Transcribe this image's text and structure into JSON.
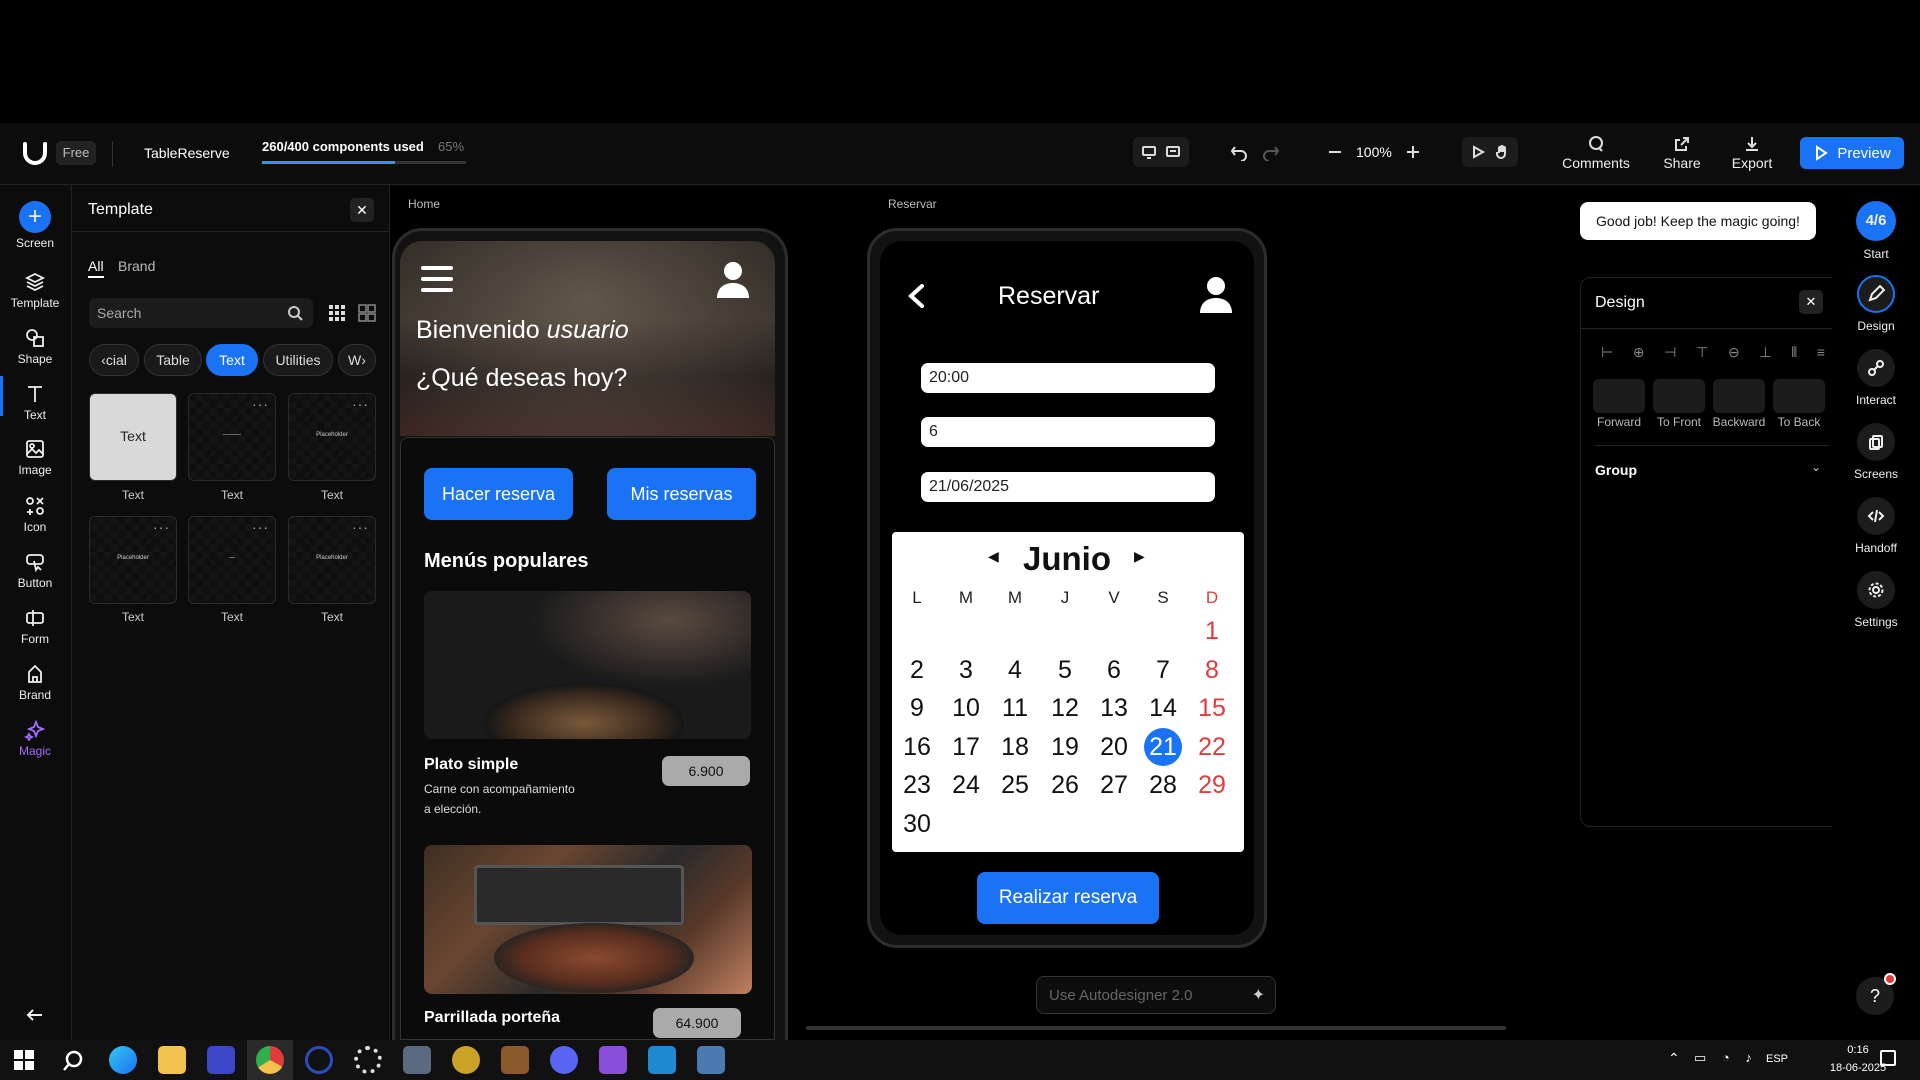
{
  "topbar": {
    "plan": "Free",
    "project": "TableReserve",
    "usage": "260/400 components used",
    "usage_percent": "65%",
    "usage_fraction": 0.65,
    "zoom": "100%",
    "comments": "Comments",
    "share": "Share",
    "export": "Export",
    "preview": "Preview"
  },
  "leftrail": [
    "Screen",
    "Template",
    "Shape",
    "Text",
    "Image",
    "Icon",
    "Button",
    "Form",
    "Brand",
    "Magic"
  ],
  "template": {
    "title": "Template",
    "tabs": [
      "All",
      "Brand"
    ],
    "search_placeholder": "Search",
    "chips": [
      "cial",
      "Table",
      "Text",
      "Utilities",
      "W"
    ],
    "cards": [
      {
        "label": "Text",
        "preview": "Text"
      },
      {
        "label": "Text",
        "preview": "———"
      },
      {
        "label": "Text",
        "preview": "Placeholder"
      },
      {
        "label": "Text",
        "preview": "Placeholder"
      },
      {
        "label": "Text",
        "preview": "—"
      },
      {
        "label": "Text",
        "preview": "Placeholder"
      }
    ]
  },
  "home": {
    "frame_label": "Home",
    "welcome": "Bienvenido",
    "user": "usuario",
    "question": "¿Qué deseas hoy?",
    "btn_reserve": "Hacer reserva",
    "btn_mine": "Mis reservas",
    "section": "Menús populares",
    "item1_name": "Plato simple",
    "item1_price": "6.900",
    "item1_desc1": "Carne con acompañamiento",
    "item1_desc2": "a elección.",
    "item2_name": "Parrillada porteña",
    "item2_price": "64.900"
  },
  "reservar": {
    "frame_label": "Reservar",
    "title": "Reservar",
    "time": "20:00",
    "people": "6",
    "date": "21/06/2025",
    "month": "Junio",
    "weekdays": [
      "L",
      "M",
      "M",
      "J",
      "V",
      "S",
      "D"
    ],
    "days": [
      "1",
      "2",
      "3",
      "4",
      "5",
      "6",
      "7",
      "8",
      "9",
      "10",
      "11",
      "12",
      "13",
      "14",
      "15",
      "16",
      "17",
      "18",
      "19",
      "20",
      "21",
      "22",
      "23",
      "24",
      "25",
      "26",
      "27",
      "28",
      "29",
      "30"
    ],
    "selected_day": "21",
    "submit": "Realizar reserva"
  },
  "autodesigner_placeholder": "Use Autodesigner 2.0",
  "toast": "Good job! Keep the magic going!",
  "design_panel": {
    "title": "Design",
    "tools": [
      "Forward",
      "To Front",
      "Backward",
      "To Back"
    ],
    "group": "Group"
  },
  "rightrail": {
    "progress": "4/6",
    "items": [
      "Start",
      "Design",
      "Interact",
      "Screens",
      "Handoff",
      "Settings"
    ]
  },
  "taskbar": {
    "lang": "ESP",
    "time": "0:16",
    "date": "18-06-2025"
  },
  "colors": {
    "accent": "#1a73f5",
    "red": "#e23b3b"
  }
}
